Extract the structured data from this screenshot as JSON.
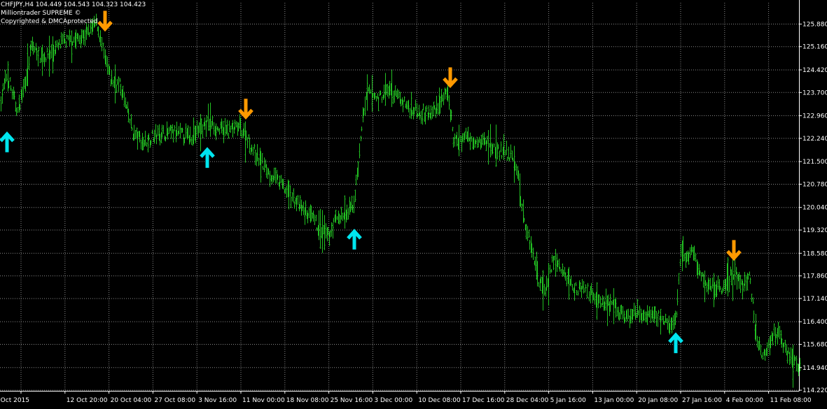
{
  "header": {
    "symbol_line": "CHFJPY,H4  104.449 104.543 104.323 104.423",
    "indicator_line": "Milliontrader SUPREME ©",
    "copyright_line": "Copyrighted & DMCAprotected"
  },
  "colors": {
    "background": "#000000",
    "grid": "#8a8a8a",
    "bars": "#22c022",
    "buy_arrow": "#00e5ee",
    "sell_arrow": "#ff9900",
    "axis_text": "#ffffff"
  },
  "chart_data": {
    "type": "ohlc",
    "ylim": [
      114.2,
      126.0
    ],
    "y_ticks": [
      "114.220",
      "114.940",
      "115.680",
      "116.400",
      "117.140",
      "117.860",
      "118.580",
      "119.320",
      "120.040",
      "120.780",
      "121.500",
      "122.240",
      "122.960",
      "123.700",
      "124.420",
      "125.160",
      "125.880"
    ],
    "x_ticks": [
      "Oct 2015",
      "12 Oct 20:00",
      "20 Oct 04:00",
      "27 Oct 08:00",
      "3 Nov 16:00",
      "11 Nov 00:00",
      "18 Nov 08:00",
      "25 Nov 16:00",
      "3 Dec 00:00",
      "10 Dec 08:00",
      "17 Dec 16:00",
      "28 Dec 04:00",
      "5 Jan 16:00",
      "13 Jan 00:00",
      "20 Jan 08:00",
      "27 Jan 16:00",
      "4 Feb 00:00",
      "11 Feb 08:00"
    ],
    "grid": true,
    "price_path": [
      [
        0,
        123.4
      ],
      [
        10,
        124.3
      ],
      [
        18,
        123.6
      ],
      [
        25,
        123.1
      ],
      [
        35,
        124.0
      ],
      [
        45,
        125.2
      ],
      [
        60,
        124.8
      ],
      [
        75,
        125.0
      ],
      [
        90,
        125.3
      ],
      [
        110,
        125.4
      ],
      [
        125,
        125.6
      ],
      [
        138,
        125.9
      ],
      [
        148,
        124.9
      ],
      [
        158,
        124.1
      ],
      [
        172,
        123.9
      ],
      [
        180,
        123.2
      ],
      [
        190,
        122.4
      ],
      [
        205,
        122.1
      ],
      [
        218,
        122.3
      ],
      [
        232,
        122.4
      ],
      [
        250,
        122.4
      ],
      [
        270,
        122.3
      ],
      [
        285,
        122.5
      ],
      [
        298,
        122.8
      ],
      [
        312,
        122.5
      ],
      [
        328,
        122.5
      ],
      [
        342,
        122.6
      ],
      [
        352,
        122.3
      ],
      [
        360,
        121.9
      ],
      [
        372,
        121.5
      ],
      [
        385,
        121.1
      ],
      [
        400,
        120.8
      ],
      [
        415,
        120.4
      ],
      [
        430,
        120.0
      ],
      [
        445,
        119.7
      ],
      [
        458,
        119.3
      ],
      [
        468,
        119.1
      ],
      [
        480,
        119.7
      ],
      [
        495,
        119.8
      ],
      [
        505,
        120.2
      ],
      [
        512,
        121.5
      ],
      [
        518,
        123.0
      ],
      [
        525,
        123.7
      ],
      [
        540,
        123.5
      ],
      [
        555,
        123.8
      ],
      [
        570,
        123.5
      ],
      [
        585,
        123.2
      ],
      [
        600,
        123.1
      ],
      [
        615,
        123.0
      ],
      [
        630,
        123.5
      ],
      [
        640,
        123.6
      ],
      [
        648,
        122.1
      ],
      [
        665,
        122.3
      ],
      [
        680,
        122.2
      ],
      [
        695,
        122.1
      ],
      [
        715,
        121.8
      ],
      [
        728,
        121.7
      ],
      [
        738,
        121.3
      ],
      [
        745,
        120.0
      ],
      [
        752,
        119.3
      ],
      [
        760,
        118.7
      ],
      [
        768,
        117.8
      ],
      [
        778,
        117.4
      ],
      [
        790,
        118.4
      ],
      [
        805,
        117.9
      ],
      [
        820,
        117.5
      ],
      [
        840,
        117.4
      ],
      [
        860,
        117.0
      ],
      [
        880,
        116.8
      ],
      [
        895,
        116.5
      ],
      [
        910,
        116.7
      ],
      [
        925,
        116.5
      ],
      [
        940,
        116.6
      ],
      [
        955,
        116.2
      ],
      [
        965,
        116.5
      ],
      [
        972,
        118.6
      ],
      [
        980,
        118.4
      ],
      [
        990,
        118.7
      ],
      [
        1000,
        117.8
      ],
      [
        1015,
        117.5
      ],
      [
        1030,
        117.5
      ],
      [
        1048,
        118.0
      ],
      [
        1060,
        117.5
      ],
      [
        1070,
        117.9
      ],
      [
        1078,
        116.2
      ],
      [
        1088,
        115.3
      ],
      [
        1098,
        115.8
      ],
      [
        1110,
        116.1
      ],
      [
        1125,
        115.4
      ],
      [
        1140,
        115.0
      ]
    ]
  },
  "arrows": {
    "buy": [
      [
        10,
        122.4
      ],
      [
        296,
        121.9
      ],
      [
        506,
        119.3
      ],
      [
        965,
        116.0
      ]
    ],
    "sell": [
      [
        150,
        125.7
      ],
      [
        351,
        122.9
      ],
      [
        643,
        123.9
      ],
      [
        1048,
        118.4
      ]
    ]
  }
}
